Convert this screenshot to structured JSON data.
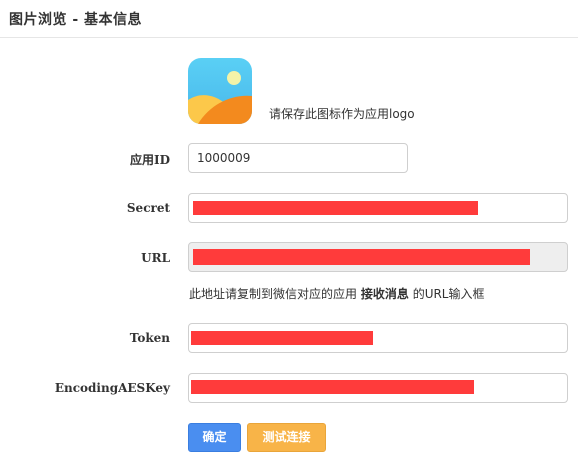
{
  "header": {
    "title": "图片浏览 - 基本信息"
  },
  "logo": {
    "hint": "请保存此图标作为应用logo",
    "icon": "landscape-image-icon"
  },
  "form": {
    "app_id": {
      "label": "应用ID",
      "value": "1000009"
    },
    "secret": {
      "label": "Secret",
      "value": ""
    },
    "url": {
      "label": "URL",
      "value": "",
      "help_prefix": "此地址请复制到微信对应的应用",
      "help_bold": "接收消息",
      "help_suffix": "的URL输入框"
    },
    "token": {
      "label": "Token",
      "value": ""
    },
    "aes_key": {
      "label": "EncodingAESKey",
      "value": ""
    }
  },
  "actions": {
    "confirm": "确定",
    "test": "测试连接"
  },
  "colors": {
    "primary": "#4a8ef0",
    "warning": "#f8b448",
    "redaction": "#ff3b3b"
  }
}
